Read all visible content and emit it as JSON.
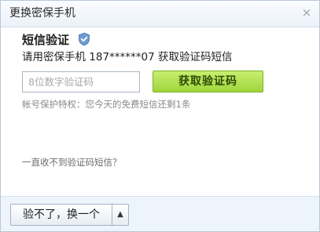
{
  "dialog": {
    "title": "更换密保手机",
    "close_glyph": "×"
  },
  "verify": {
    "heading": "短信验证",
    "phone_line": "请用密保手机 187******07 获取验证码短信",
    "code_placeholder": "8位数字验证码",
    "code_value": "",
    "get_code_label": "获取验证码",
    "privilege_note": "帐号保护特权：您今天的免费短信还剩1条",
    "help_link": "一直收不到验证码短信？"
  },
  "footer": {
    "switch_label": "验不了，换一个",
    "arrow_glyph": "▲"
  },
  "colors": {
    "accent_green": "#9fd63b",
    "shield_blue": "#6d9bd1",
    "titlebar": "#eaf1f8",
    "footer": "#eef4fb"
  },
  "icons": {
    "close": "close-icon",
    "shield": "shield-icon",
    "arrow": "arrow-up-icon"
  }
}
